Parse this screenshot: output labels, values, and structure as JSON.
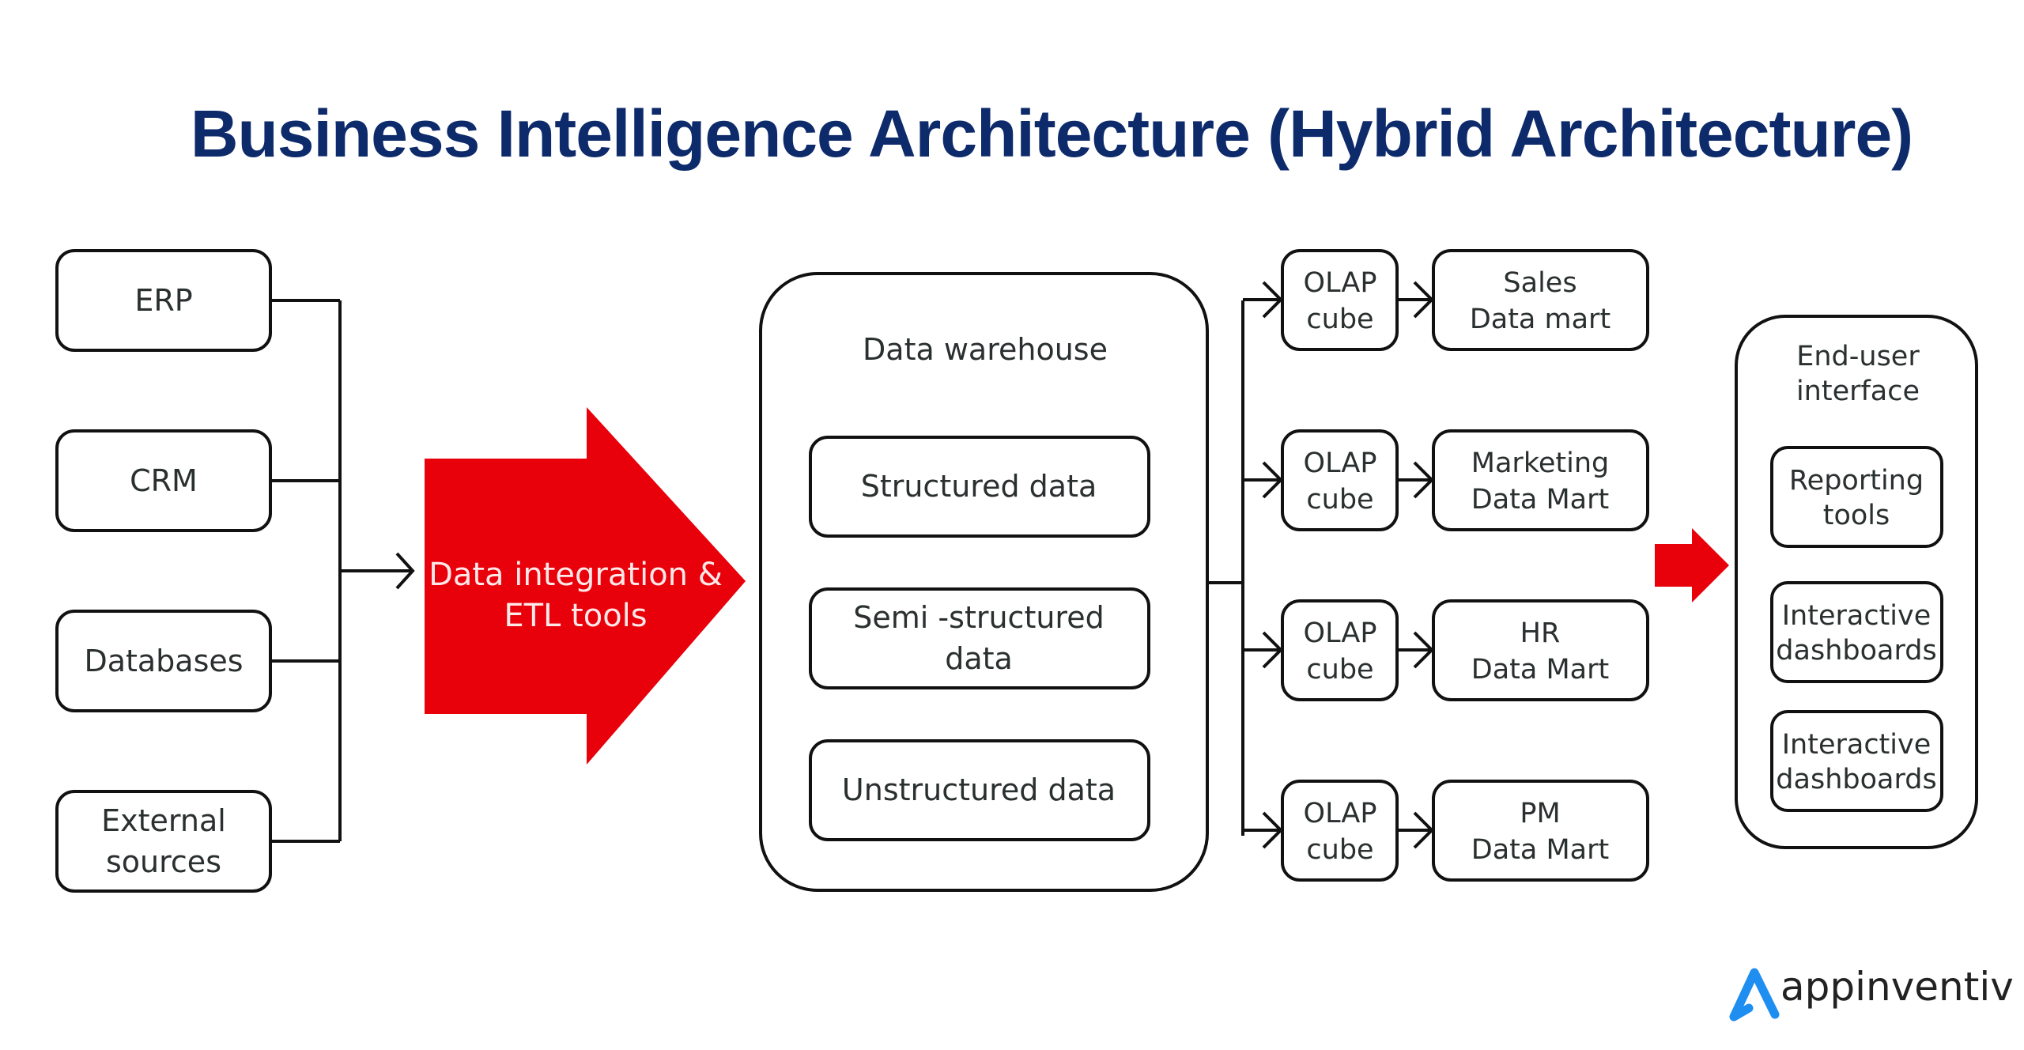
{
  "title": "Business Intelligence Architecture (Hybrid Architecture)",
  "colors": {
    "title": "#0d2a6b",
    "accent_red": "#e8000b",
    "logo_blue": "#1f8ef1",
    "stroke": "#111111"
  },
  "sources": [
    {
      "lines": [
        "ERP"
      ]
    },
    {
      "lines": [
        "CRM"
      ]
    },
    {
      "lines": [
        "Databases"
      ]
    },
    {
      "lines": [
        "External",
        "sources"
      ]
    }
  ],
  "etl": {
    "lines": [
      "Data integration &",
      "ETL tools"
    ]
  },
  "warehouse": {
    "title": "Data warehouse",
    "items": [
      {
        "lines": [
          "Structured data"
        ]
      },
      {
        "lines": [
          "Semi -structured",
          "data"
        ]
      },
      {
        "lines": [
          "Unstructured data"
        ]
      }
    ]
  },
  "olap_rows": [
    {
      "cube": [
        "OLAP",
        "cube"
      ],
      "mart": [
        "Sales",
        "Data mart"
      ]
    },
    {
      "cube": [
        "OLAP",
        "cube"
      ],
      "mart": [
        "Marketing",
        "Data Mart"
      ]
    },
    {
      "cube": [
        "OLAP",
        "cube"
      ],
      "mart": [
        "HR",
        "Data Mart"
      ]
    },
    {
      "cube": [
        "OLAP",
        "cube"
      ],
      "mart": [
        "PM",
        "Data Mart"
      ]
    }
  ],
  "end_user": {
    "title": [
      "End-user",
      "interface"
    ],
    "items": [
      {
        "lines": [
          "Reporting",
          "tools"
        ]
      },
      {
        "lines": [
          "Interactive",
          "dashboards"
        ]
      },
      {
        "lines": [
          "Interactive",
          "dashboards"
        ]
      }
    ]
  },
  "logo": {
    "text": "appinventiv",
    "icon": "appinventiv-a-icon"
  }
}
